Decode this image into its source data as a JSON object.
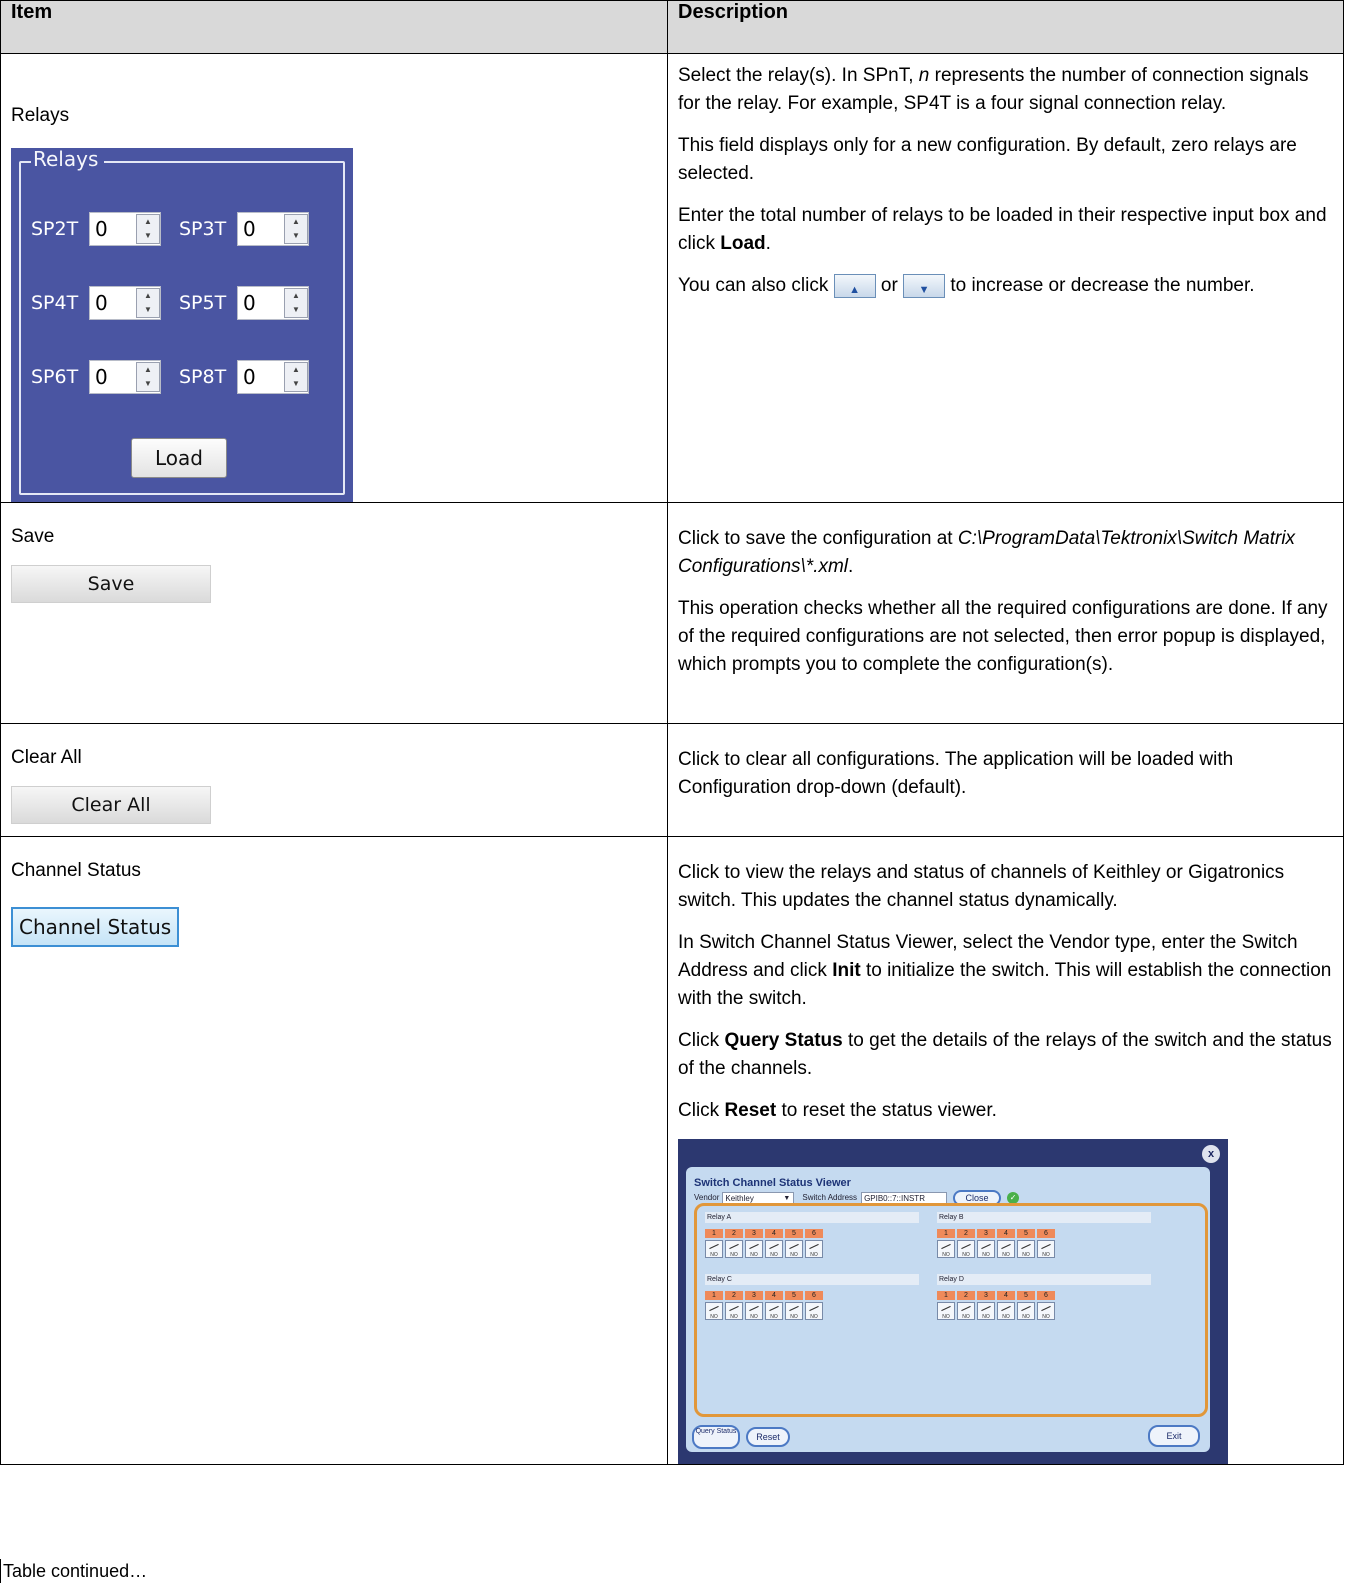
{
  "table": {
    "header_item": "Item",
    "header_description": "Description",
    "footer": "Table continued…"
  },
  "relays": {
    "item_label": "Relays",
    "panel_title": "Relays",
    "fields": [
      {
        "label": "SP2T",
        "value": "0"
      },
      {
        "label": "SP3T",
        "value": "0"
      },
      {
        "label": "SP4T",
        "value": "0"
      },
      {
        "label": "SP5T",
        "value": "0"
      },
      {
        "label": "SP6T",
        "value": "0"
      },
      {
        "label": "SP8T",
        "value": "0"
      }
    ],
    "load_button": "Load",
    "desc": {
      "p1_a": "Select the relay(s). In SPnT, ",
      "p1_em": "n",
      "p1_b": " represents the number of connection signals for the relay. For example, SP4T is a four signal connection relay.",
      "p2": "This field displays only for a new configuration. By default, zero relays are selected.",
      "p3_a": "Enter the total number of relays to be loaded in their respective input box and click ",
      "p3_b": "Load",
      "p3_c": ".",
      "p4_a": "You can also click ",
      "p4_b": " or ",
      "p4_c": " to increase or decrease the number."
    }
  },
  "save": {
    "item_label": "Save",
    "button": "Save",
    "desc": {
      "p1_a": "Click to save the configuration at ",
      "p1_path": "C:\\ProgramData\\Tektronix\\Switch Matrix Configurations\\*.xml",
      "p1_b": ".",
      "p2": "This operation checks whether all the required configurations are done. If any of the required configurations are not selected, then error popup is displayed, which prompts you to complete the configuration(s)."
    }
  },
  "clear_all": {
    "item_label": "Clear All",
    "button": "Clear All",
    "desc": "Click to clear all configurations. The application will be loaded with Configuration drop-down (default)."
  },
  "channel_status": {
    "item_label": "Channel Status",
    "button": "Channel Status",
    "desc": {
      "p1": "Click to view the relays and status of channels of Keithley or Gigatronics switch. This updates the channel status dynamically.",
      "p2_a": "In Switch Channel Status Viewer, select the Vendor type, enter the Switch Address and click ",
      "p2_b": "Init",
      "p2_c": " to initialize the switch. This will establish the connection with the switch.",
      "p3_a": "Click ",
      "p3_b": "Query Status",
      "p3_c": " to get the details of the relays of the switch and the status of the channels.",
      "p4_a": "Click ",
      "p4_b": "Reset",
      "p4_c": " to reset the status viewer."
    },
    "viewer": {
      "title": "Switch Channel Status Viewer",
      "vendor_label": "Vendor",
      "vendor_value": "Keithley",
      "address_label": "Switch Address",
      "address_value": "GPIB0::7::INSTR",
      "close_button": "Close",
      "relays": [
        "Relay A",
        "Relay B",
        "Relay C",
        "Relay D"
      ],
      "channels": [
        "1",
        "2",
        "3",
        "4",
        "5",
        "6"
      ],
      "switch_state": "NO",
      "query_button": "Query Status",
      "reset_button": "Reset",
      "exit_button": "Exit"
    }
  }
}
